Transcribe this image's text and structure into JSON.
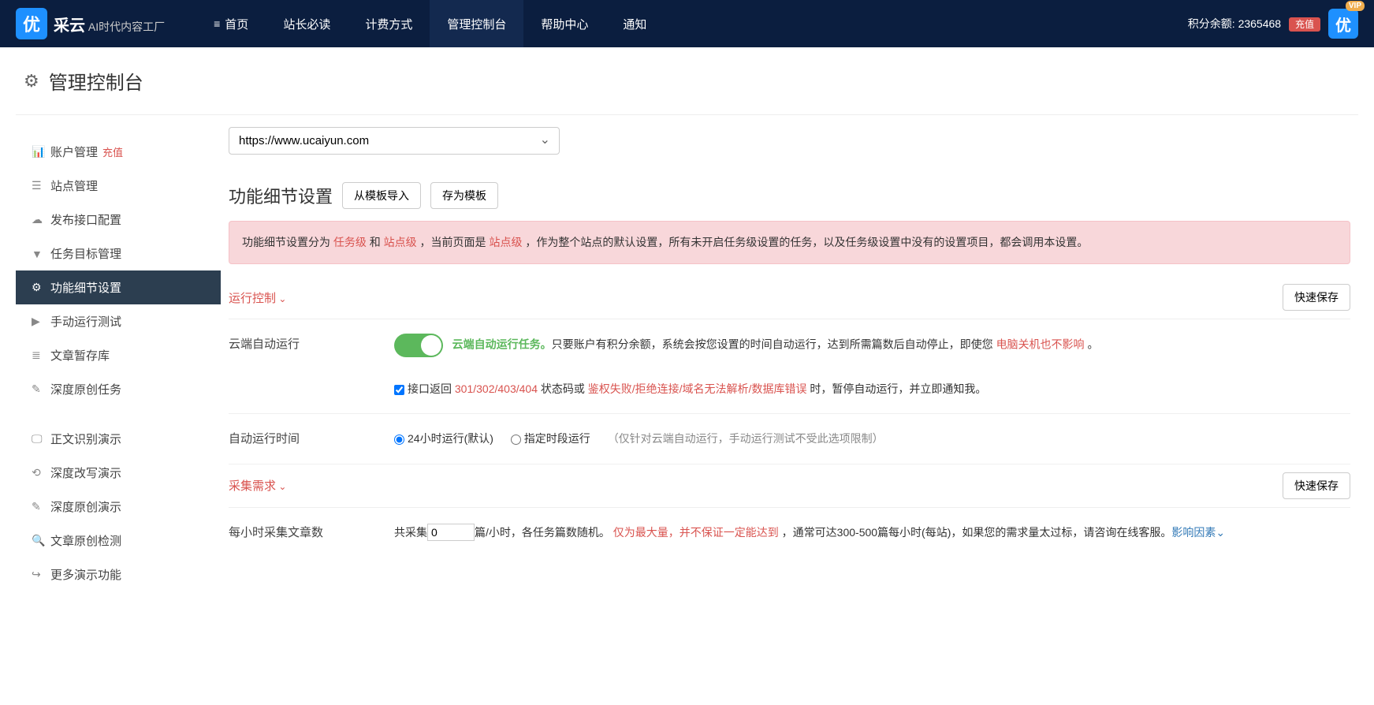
{
  "brand": {
    "logo": "优",
    "name": "采云",
    "tagline": "AI时代内容工厂"
  },
  "topnav": [
    {
      "label": "首页",
      "icon": "≡"
    },
    {
      "label": "站长必读"
    },
    {
      "label": "计费方式"
    },
    {
      "label": "管理控制台",
      "active": true
    },
    {
      "label": "帮助中心"
    },
    {
      "label": "通知"
    }
  ],
  "points": {
    "label": "积分余额:",
    "value": "2365468",
    "recharge": "充值"
  },
  "avatar": {
    "text": "优",
    "vip": "VIP"
  },
  "page_title": "管理控制台",
  "sidebar": {
    "group1": [
      {
        "icon": "📊",
        "label": "账户管理",
        "badge": "充值"
      },
      {
        "icon": "☰",
        "label": "站点管理"
      },
      {
        "icon": "☁",
        "label": "发布接口配置"
      },
      {
        "icon": "▼",
        "label": "任务目标管理"
      },
      {
        "icon": "⚙",
        "label": "功能细节设置",
        "active": true
      },
      {
        "icon": "▶",
        "label": "手动运行测试"
      },
      {
        "icon": "≣",
        "label": "文章暂存库"
      },
      {
        "icon": "✎",
        "label": "深度原创任务"
      }
    ],
    "group2": [
      {
        "icon": "🖵",
        "label": "正文识别演示"
      },
      {
        "icon": "⟲",
        "label": "深度改写演示"
      },
      {
        "icon": "✎",
        "label": "深度原创演示"
      },
      {
        "icon": "🔍",
        "label": "文章原创检测"
      },
      {
        "icon": "↪",
        "label": "更多演示功能"
      }
    ]
  },
  "site_select": "https://www.ucaiyun.com",
  "section": {
    "title": "功能细节设置",
    "import": "从模板导入",
    "save_tpl": "存为模板"
  },
  "alert": {
    "t1": "功能细节设置分为 ",
    "task": "任务级",
    "t2": " 和 ",
    "site": "站点级",
    "t3": " ，当前页面是 ",
    "site2": "站点级",
    "t4": " ，作为整个站点的默认设置，所有未开启任务级设置的任务，以及任务级设置中没有的设置项目，都会调用本设置。"
  },
  "groups": {
    "run": "运行控制",
    "collect": "采集需求",
    "quick_save": "快速保存"
  },
  "run": {
    "auto_label": "云端自动运行",
    "auto_title": "云端自动运行任务。",
    "auto_desc": "只要账户有积分余额，系统会按您设置的时间自动运行，达到所需篇数后自动停止，即使您 ",
    "auto_red": "电脑关机也不影响",
    "auto_desc2": " 。",
    "cb_pre": "接口返回 ",
    "cb_codes": "301/302/403/404",
    "cb_mid": " 状态码或 ",
    "cb_errors": "鉴权失败/拒绝连接/域名无法解析/数据库错误",
    "cb_post": " 时，暂停自动运行，并立即通知我。",
    "time_label": "自动运行时间",
    "time_opt1": "24小时运行(默认)",
    "time_opt2": "指定时段运行",
    "time_hint": "（仅针对云端自动运行，手动运行测试不受此选项限制）"
  },
  "collect": {
    "label": "每小时采集文章数",
    "pre": "共采集",
    "value": "0",
    "post": "篇/小时，各任务篇数随机。 ",
    "warn": "仅为最大量，并不保证一定能达到",
    "desc2": " ，通常可达300-500篇每小时(每站)，如果您的需求量太过标，请咨询在线客服。",
    "link": "影响因素⌄"
  }
}
